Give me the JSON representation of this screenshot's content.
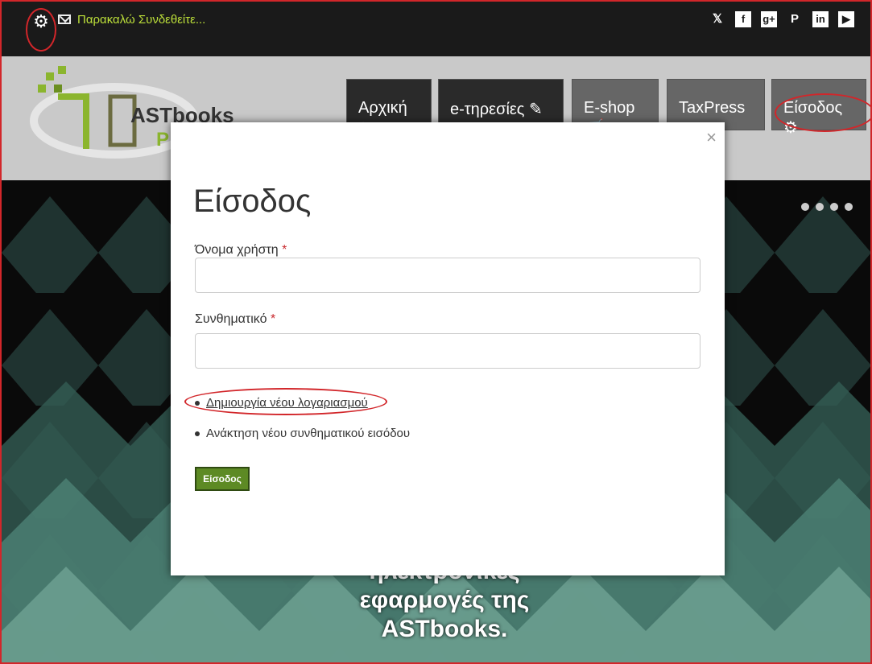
{
  "topbar": {
    "login_prompt": "Παρακαλώ Συνδεθείτε...",
    "social_icons": [
      "twitter-icon",
      "facebook-icon",
      "googleplus-icon",
      "pinterest-icon",
      "linkedin-icon",
      "youtube-icon"
    ],
    "social_glyphs": [
      "𝕏",
      "f",
      "g+",
      "P",
      "in",
      "▶"
    ]
  },
  "header": {
    "brand": "ASTbooks",
    "brand_letter": "P",
    "nav": [
      {
        "label": "Αρχική",
        "icon": "home-icon"
      },
      {
        "label": "e-τηρεσίες",
        "icon": "edit-icon"
      },
      {
        "label": "E-shop",
        "icon": "cart-icon"
      },
      {
        "label": "TaxPress",
        "icon": "taxpress-icon"
      },
      {
        "label": "Είσοδος",
        "icon": "gear-icon"
      }
    ]
  },
  "hero": {
    "text": [
      "ηλεκτρονικές",
      "εφαρμογές της",
      "ASTbooks."
    ]
  },
  "modal": {
    "close": "×",
    "title": "Είσοδος",
    "username_label": "Όνομα χρήστη",
    "password_label": "Συνθηματικό",
    "required_mark": "*",
    "create_account": "Δημιουργία νέου λογαριασμού",
    "recover_password": "Ανάκτηση νέου συνθηματικού εισόδου",
    "submit": "Είσοδος"
  },
  "colors": {
    "accent_green": "#5d8a24",
    "highlight_red": "#d2262a",
    "login_prompt": "#bde03a"
  }
}
